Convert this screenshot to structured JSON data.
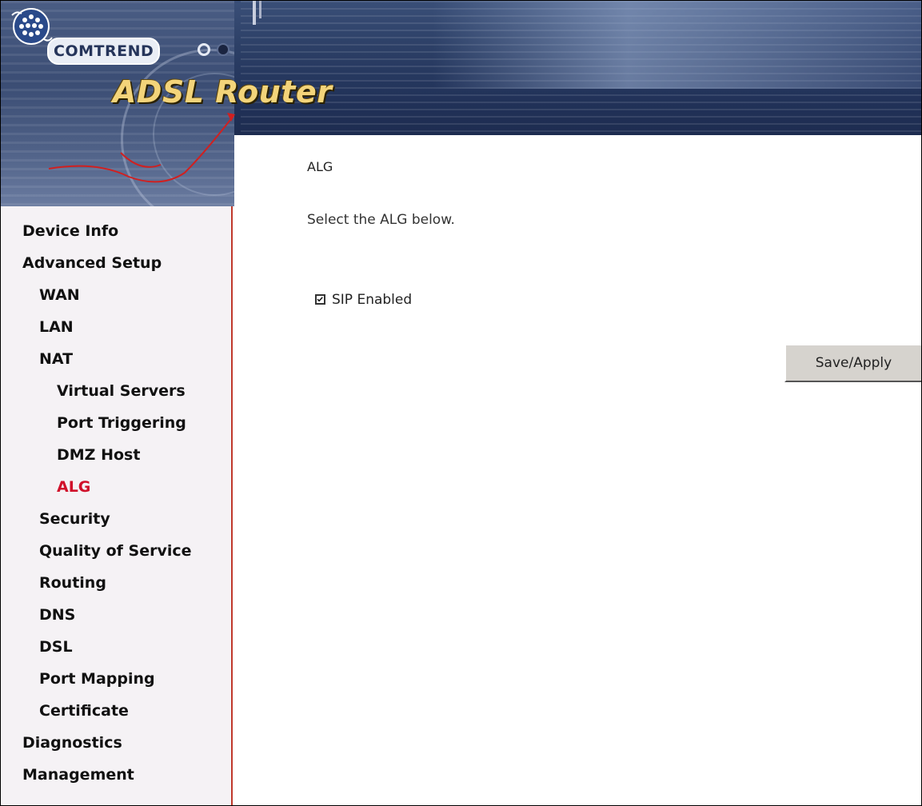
{
  "header": {
    "brand": "COMTREND",
    "product": "ADSL Router"
  },
  "sidebar": {
    "items": [
      {
        "label": "Device Info",
        "level": 0,
        "active": false
      },
      {
        "label": "Advanced Setup",
        "level": 0,
        "active": false
      },
      {
        "label": "WAN",
        "level": 1,
        "active": false
      },
      {
        "label": "LAN",
        "level": 1,
        "active": false
      },
      {
        "label": "NAT",
        "level": 1,
        "active": false
      },
      {
        "label": "Virtual Servers",
        "level": 2,
        "active": false
      },
      {
        "label": "Port Triggering",
        "level": 2,
        "active": false
      },
      {
        "label": "DMZ Host",
        "level": 2,
        "active": false
      },
      {
        "label": "ALG",
        "level": 2,
        "active": true
      },
      {
        "label": "Security",
        "level": 1,
        "active": false
      },
      {
        "label": "Quality of Service",
        "level": 1,
        "active": false
      },
      {
        "label": "Routing",
        "level": 1,
        "active": false
      },
      {
        "label": "DNS",
        "level": 1,
        "active": false
      },
      {
        "label": "DSL",
        "level": 1,
        "active": false
      },
      {
        "label": "Port Mapping",
        "level": 1,
        "active": false
      },
      {
        "label": "Certificate",
        "level": 1,
        "active": false
      },
      {
        "label": "Diagnostics",
        "level": 0,
        "active": false
      },
      {
        "label": "Management",
        "level": 0,
        "active": false
      }
    ]
  },
  "main": {
    "title": "ALG",
    "description": "Select the ALG below.",
    "sip_label": "SIP Enabled",
    "sip_checked": true,
    "save_label": "Save/Apply"
  },
  "colors": {
    "active_nav": "#d0102a",
    "sidebar_border": "#c0392b",
    "sidebar_bg": "#f5f2f5",
    "banner": "#2c3f66"
  }
}
